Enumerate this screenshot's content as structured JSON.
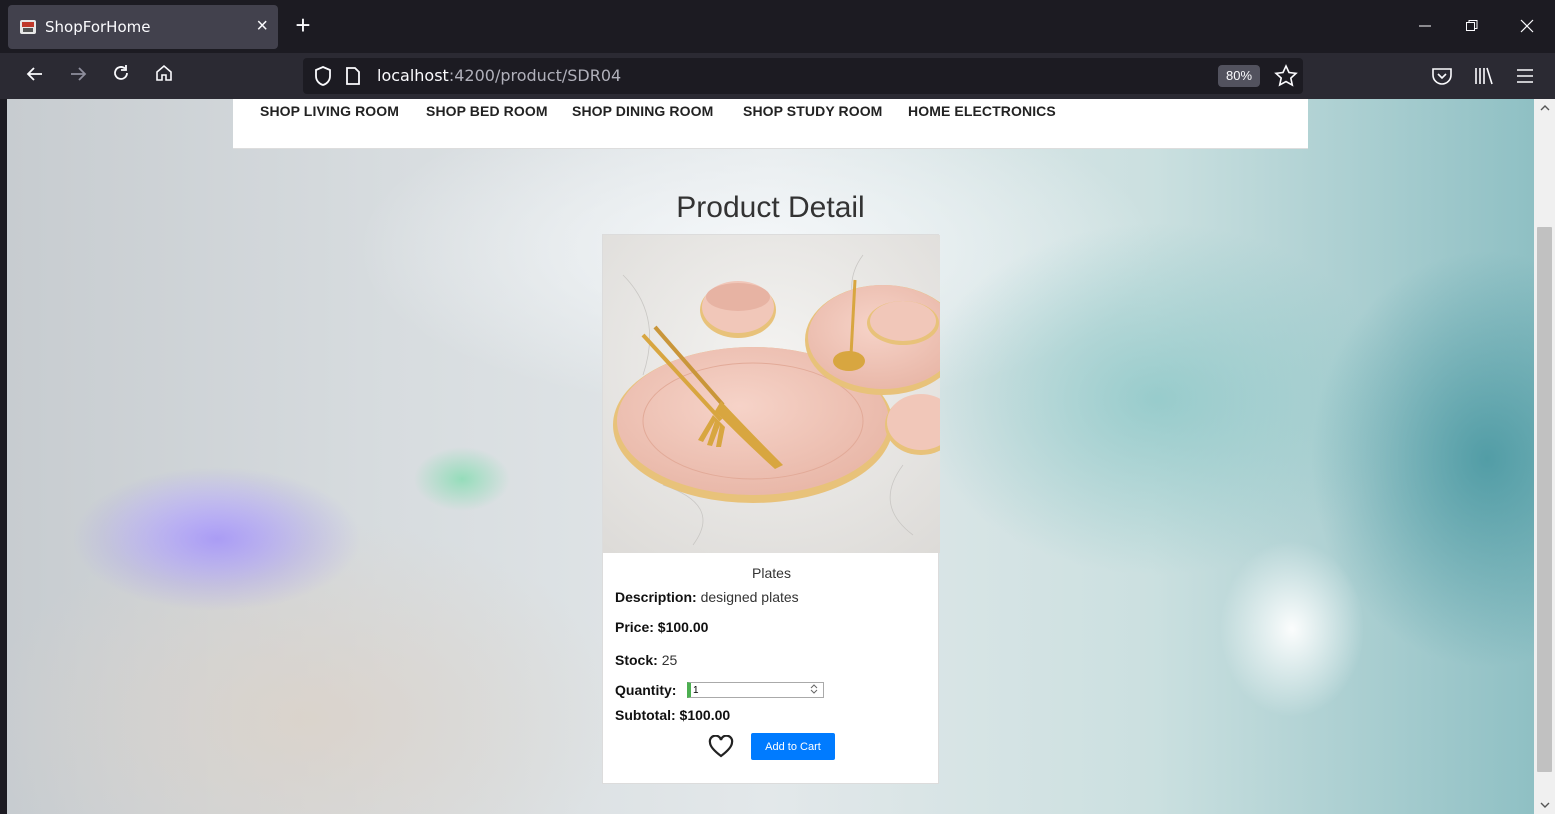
{
  "browser": {
    "tab_title": "ShopForHome",
    "tab_close": "×",
    "new_tab": "+",
    "url_host": "localhost",
    "url_rest": ":4200/product/SDR04",
    "zoom": "80%"
  },
  "site_nav": {
    "items": [
      {
        "label": "SHOP LIVING ROOM"
      },
      {
        "label": "SHOP BED ROOM"
      },
      {
        "label": "SHOP DINING ROOM"
      },
      {
        "label": "SHOP STUDY ROOM"
      },
      {
        "label": "HOME ELECTRONICS"
      }
    ]
  },
  "page": {
    "title": "Product Detail"
  },
  "product": {
    "name": "Plates",
    "description_label": "Description:",
    "description": "designed plates",
    "price_label": "Price: $100.00",
    "stock_label": "Stock:",
    "stock": "25",
    "quantity_label": "Quantity:",
    "quantity": "1",
    "subtotal_label": "Subtotal: $100.00",
    "add_to_cart": "Add to Cart"
  }
}
